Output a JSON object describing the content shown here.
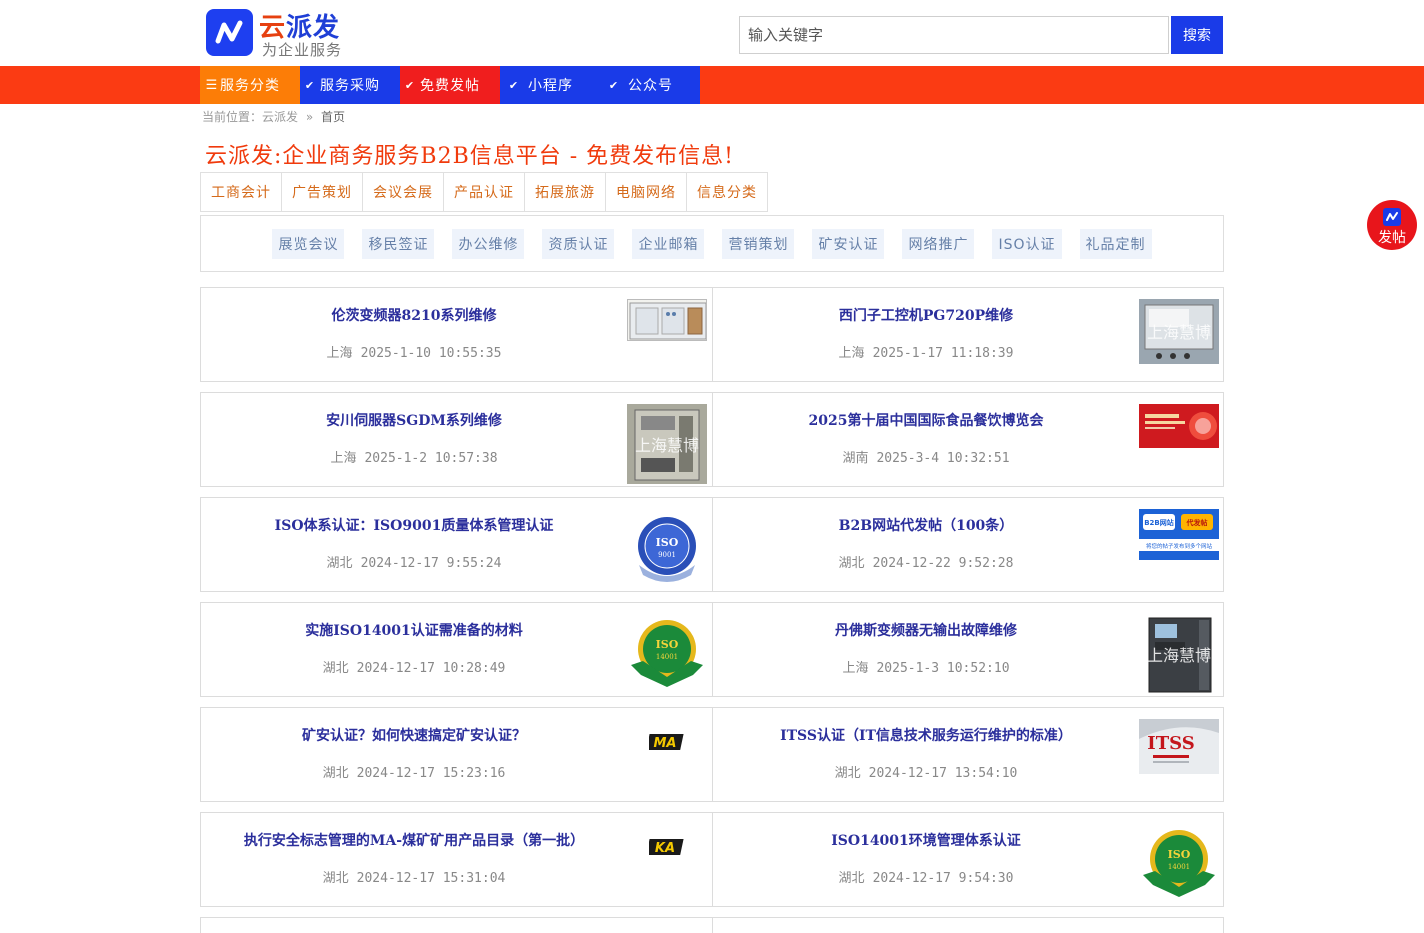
{
  "brand": {
    "name_first": "云",
    "name_rest": "派发",
    "slogan": "为企业服务"
  },
  "search": {
    "placeholder": "输入关键字",
    "button_label": "搜索"
  },
  "nav": {
    "items": [
      {
        "label": "服务分类",
        "icon": "menu-icon",
        "color": "#fc7d07"
      },
      {
        "label": "服务采购",
        "icon": "chevron-down-icon",
        "color": "#1a3be8"
      },
      {
        "label": "免费发帖",
        "icon": "chevron-down-icon",
        "color": "#f01e1e"
      },
      {
        "label": "小程序",
        "icon": "chevron-down-icon",
        "color": "#1a3be8"
      },
      {
        "label": "公众号",
        "icon": "chevron-down-icon",
        "color": "#1a3be8"
      }
    ],
    "bar_color": "#fb3b13"
  },
  "breadcrumb": {
    "prefix": "当前位置：",
    "site": "云派发",
    "sep": "»",
    "current": "首页"
  },
  "page_title": "云派发:企业商务服务B2B信息平台 - 免费发布信息!",
  "tabs": [
    "工商会计",
    "广告策划",
    "会议会展",
    "产品认证",
    "拓展旅游",
    "电脑网络",
    "信息分类"
  ],
  "tags": [
    "展览会议",
    "移民签证",
    "办公维修",
    "资质认证",
    "企业邮箱",
    "营销策划",
    "矿安认证",
    "网络推广",
    "ISO认证",
    "礼品定制"
  ],
  "posts": [
    {
      "title": "伦茨变频器8210系列维修",
      "region": "上海",
      "time": "2025-1-10 10:55:35",
      "thumb": "device-photo"
    },
    {
      "title": "西门子工控机PG720P维修",
      "region": "上海",
      "time": "2025-1-17 11:18:39",
      "thumb": "device-photo",
      "watermark": "上海慧博"
    },
    {
      "title": "安川伺服器SGDM系列维修",
      "region": "上海",
      "time": "2025-1-2 10:57:38",
      "thumb": "device-photo",
      "watermark": "上海慧博"
    },
    {
      "title": "2025第十届中国国际食品餐饮博览会",
      "region": "湖南",
      "time": "2025-3-4 10:32:51",
      "thumb": "expo-banner"
    },
    {
      "title": "ISO体系认证：ISO9001质量体系管理认证",
      "region": "湖北",
      "time": "2024-12-17 9:55:24",
      "thumb": "iso-9001-seal",
      "seal_text": "ISO",
      "seal_sub": "9001"
    },
    {
      "title": "B2B网站代发帖（100条）",
      "region": "湖北",
      "time": "2024-12-22 9:52:28",
      "thumb": "b2b-banner",
      "badge_a": "B2B网站",
      "badge_b": "代发帖",
      "caption": "将您的帖子发布到多个网站"
    },
    {
      "title": "实施ISO14001认证需准备的材料",
      "region": "湖北",
      "time": "2024-12-17 10:28:49",
      "thumb": "iso-14001-seal",
      "seal_text": "ISO",
      "seal_sub": "14001"
    },
    {
      "title": "丹佛斯变频器无输出故障维修",
      "region": "上海",
      "time": "2025-1-3 10:52:10",
      "thumb": "device-photo",
      "watermark": "上海慧博"
    },
    {
      "title": "矿安认证？如何快速搞定矿安认证？",
      "region": "湖北",
      "time": "2024-12-17 15:23:16",
      "thumb": "ma-logo",
      "logo_text": "MA"
    },
    {
      "title": "ITSS认证（IT信息技术服务运行维护的标准）",
      "region": "湖北",
      "time": "2024-12-17 13:54:10",
      "thumb": "itss-logo",
      "logo_text": "ITSS"
    },
    {
      "title": "执行安全标志管理的MA-煤矿矿用产品目录（第一批）",
      "region": "湖北",
      "time": "2024-12-17 15:31:04",
      "thumb": "ka-logo",
      "logo_text": "KA"
    },
    {
      "title": "ISO14001环境管理体系认证",
      "region": "湖北",
      "time": "2024-12-17 9:54:30",
      "thumb": "iso-14001-seal",
      "seal_text": "ISO",
      "seal_sub": "14001"
    }
  ],
  "float_button": {
    "label": "发帖"
  }
}
